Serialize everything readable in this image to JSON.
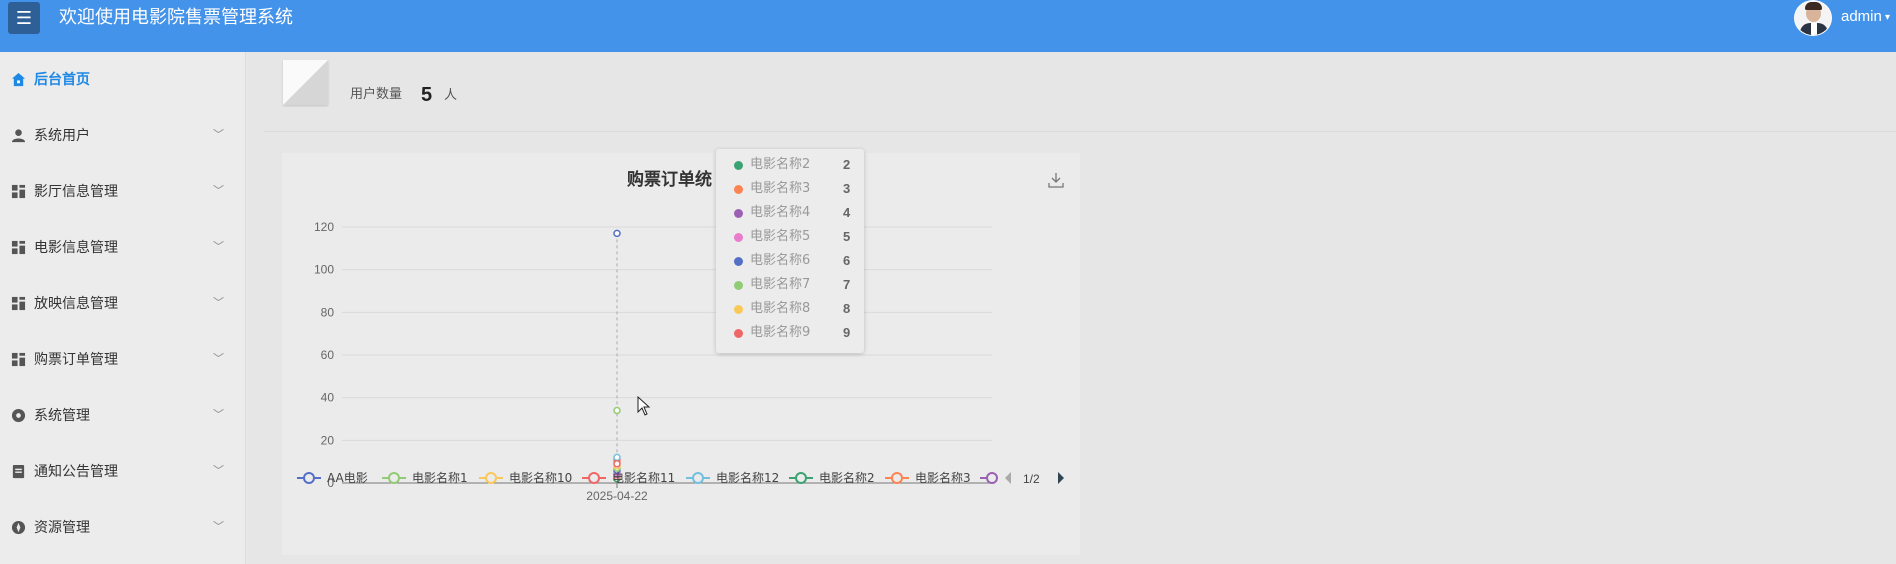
{
  "header": {
    "menu_icon": "hamburger-icon",
    "title": "欢迎使用电影院售票管理系统",
    "user": "admin",
    "brand_color": "#4493ea"
  },
  "sidebar": {
    "items": [
      {
        "label": "后台首页",
        "icon": "home-icon",
        "active": true
      },
      {
        "label": "系统用户",
        "icon": "user-icon"
      },
      {
        "label": "影厅信息管理",
        "icon": "grid-icon"
      },
      {
        "label": "电影信息管理",
        "icon": "grid-icon"
      },
      {
        "label": "放映信息管理",
        "icon": "grid-icon"
      },
      {
        "label": "购票订单管理",
        "icon": "grid-icon"
      },
      {
        "label": "系统管理",
        "icon": "gear-icon"
      },
      {
        "label": "通知公告管理",
        "icon": "document-icon"
      },
      {
        "label": "资源管理",
        "icon": "compass-icon"
      }
    ]
  },
  "stats": {
    "label": "用户数量",
    "value": "5",
    "unit": "人"
  },
  "chart_data": {
    "type": "line",
    "title": "购票订单统",
    "categories": [
      "2025-04-22"
    ],
    "y_ticks": [
      0,
      20,
      40,
      60,
      80,
      100,
      120
    ],
    "ylim": [
      0,
      120
    ],
    "grid": true,
    "series": [
      {
        "name": "AA电影",
        "color": "#5470c6",
        "values": [
          117
        ]
      },
      {
        "name": "电影名称1",
        "color": "#91cc75",
        "values": [
          34
        ]
      },
      {
        "name": "电影名称10",
        "color": "#fac858",
        "values": [
          10
        ]
      },
      {
        "name": "电影名称11",
        "color": "#ee6666",
        "values": [
          11
        ]
      },
      {
        "name": "电影名称12",
        "color": "#73c0de",
        "values": [
          12
        ]
      },
      {
        "name": "电影名称2",
        "color": "#3ba272",
        "values": [
          2
        ]
      },
      {
        "name": "电影名称3",
        "color": "#fc8452",
        "values": [
          3
        ]
      },
      {
        "name": "电影名称4",
        "color": "#9a60b4",
        "values": [
          4
        ]
      },
      {
        "name": "电影名称5",
        "color": "#ea7ccc",
        "values": [
          5
        ]
      },
      {
        "name": "电影名称6",
        "color": "#5470c6",
        "values": [
          6
        ]
      },
      {
        "name": "电影名称7",
        "color": "#91cc75",
        "values": [
          7
        ]
      },
      {
        "name": "电影名称8",
        "color": "#fac858",
        "values": [
          8
        ]
      },
      {
        "name": "电影名称9",
        "color": "#ee6666",
        "values": [
          9
        ]
      }
    ],
    "legend_page": "1/2"
  },
  "tooltip": [
    {
      "name": "电影名称2",
      "value": "2",
      "color": "#3ba272"
    },
    {
      "name": "电影名称3",
      "value": "3",
      "color": "#fc8452"
    },
    {
      "name": "电影名称4",
      "value": "4",
      "color": "#9a60b4"
    },
    {
      "name": "电影名称5",
      "value": "5",
      "color": "#ea7ccc"
    },
    {
      "name": "电影名称6",
      "value": "6",
      "color": "#5470c6"
    },
    {
      "name": "电影名称7",
      "value": "7",
      "color": "#91cc75"
    },
    {
      "name": "电影名称8",
      "value": "8",
      "color": "#fac858"
    },
    {
      "name": "电影名称9",
      "value": "9",
      "color": "#ee6666"
    }
  ]
}
